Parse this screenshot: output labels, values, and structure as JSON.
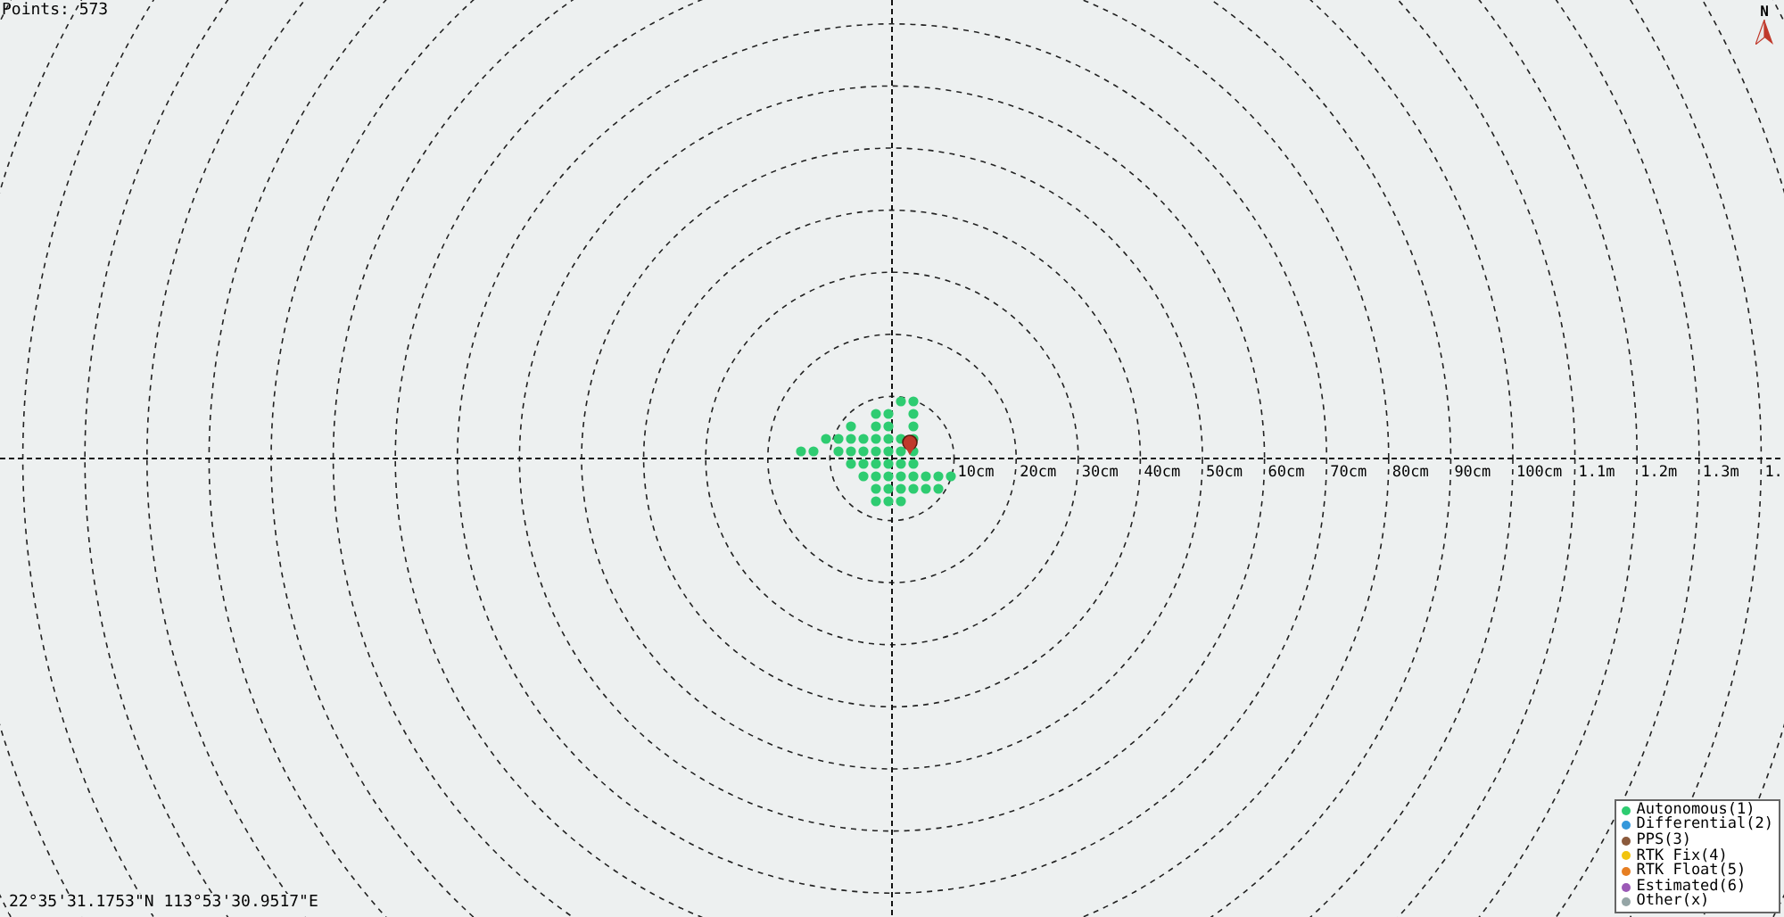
{
  "points_label": "Points: 573",
  "north_label": "N",
  "ring_labels": [
    "10cm",
    "20cm",
    "30cm",
    "40cm",
    "50cm",
    "60cm",
    "70cm",
    "80cm",
    "90cm",
    "100cm",
    "1.1m",
    "1.2m",
    "1.3m",
    "1."
  ],
  "position": "22°35'31.1753\"N 113°53'30.9517\"E",
  "legend": [
    {
      "label": "Autonomous(1)",
      "color": "#2ecc71"
    },
    {
      "label": "Differential(2)",
      "color": "#3498db"
    },
    {
      "label": "PPS(3)",
      "color": "#8b5a3c"
    },
    {
      "label": "RTK Fix(4)",
      "color": "#f1c40f"
    },
    {
      "label": "RTK Float(5)",
      "color": "#e67e22"
    },
    {
      "label": "Estimated(6)",
      "color": "#9b59b6"
    },
    {
      "label": "Other(x)",
      "color": "#95a5a6"
    }
  ]
}
